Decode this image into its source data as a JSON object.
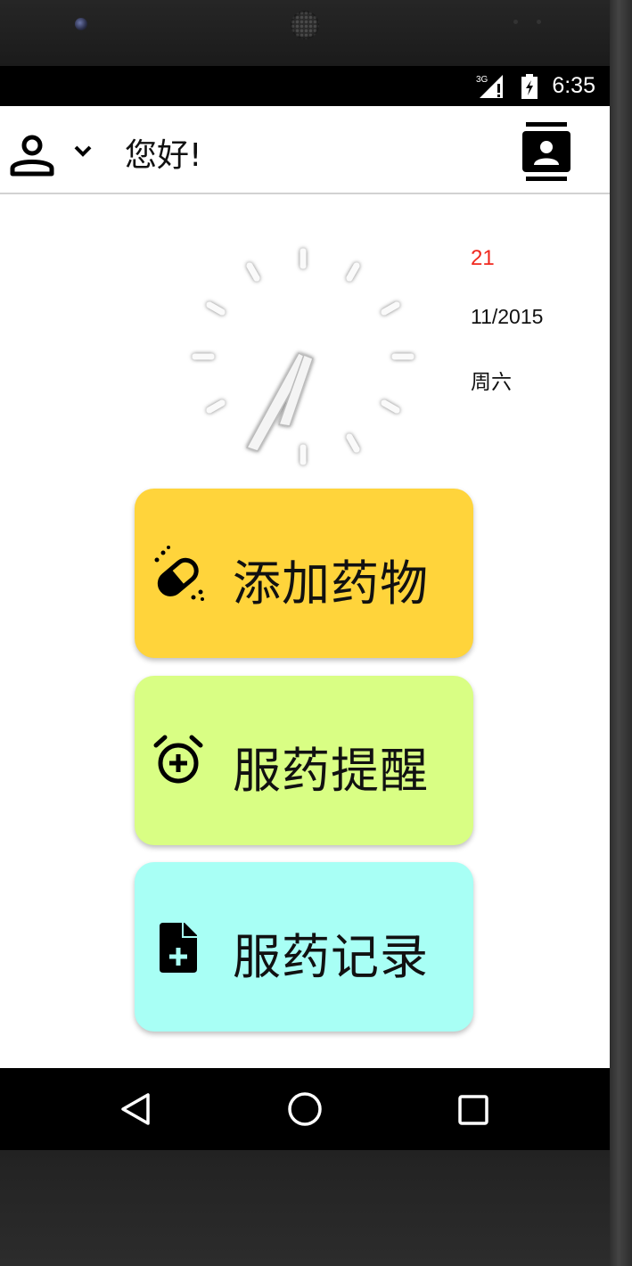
{
  "status_bar": {
    "time": "6:35",
    "network_type": "3G",
    "signal_icon": "signal-icon",
    "battery_icon": "battery-icon"
  },
  "app_bar": {
    "greeting": "您好!",
    "user_icon": "user-icon",
    "dropdown_icon": "chevron-down-icon",
    "contacts_icon": "contacts-icon"
  },
  "date_panel": {
    "day": "21",
    "month_year": "11/2015",
    "weekday": "周六",
    "day_color": "#f0281e"
  },
  "clock": {
    "hour": 6,
    "minute": 35
  },
  "actions": [
    {
      "label": "添加药物",
      "icon": "pill-icon",
      "color": "#ffd43b"
    },
    {
      "label": "服药提醒",
      "icon": "alarm-add-icon",
      "color": "#d9fe84"
    },
    {
      "label": "服药记录",
      "icon": "note-add-icon",
      "color": "#a8fff5"
    }
  ],
  "nav_bar": {
    "back_icon": "back-icon",
    "home_icon": "home-icon",
    "recents_icon": "recents-icon"
  }
}
